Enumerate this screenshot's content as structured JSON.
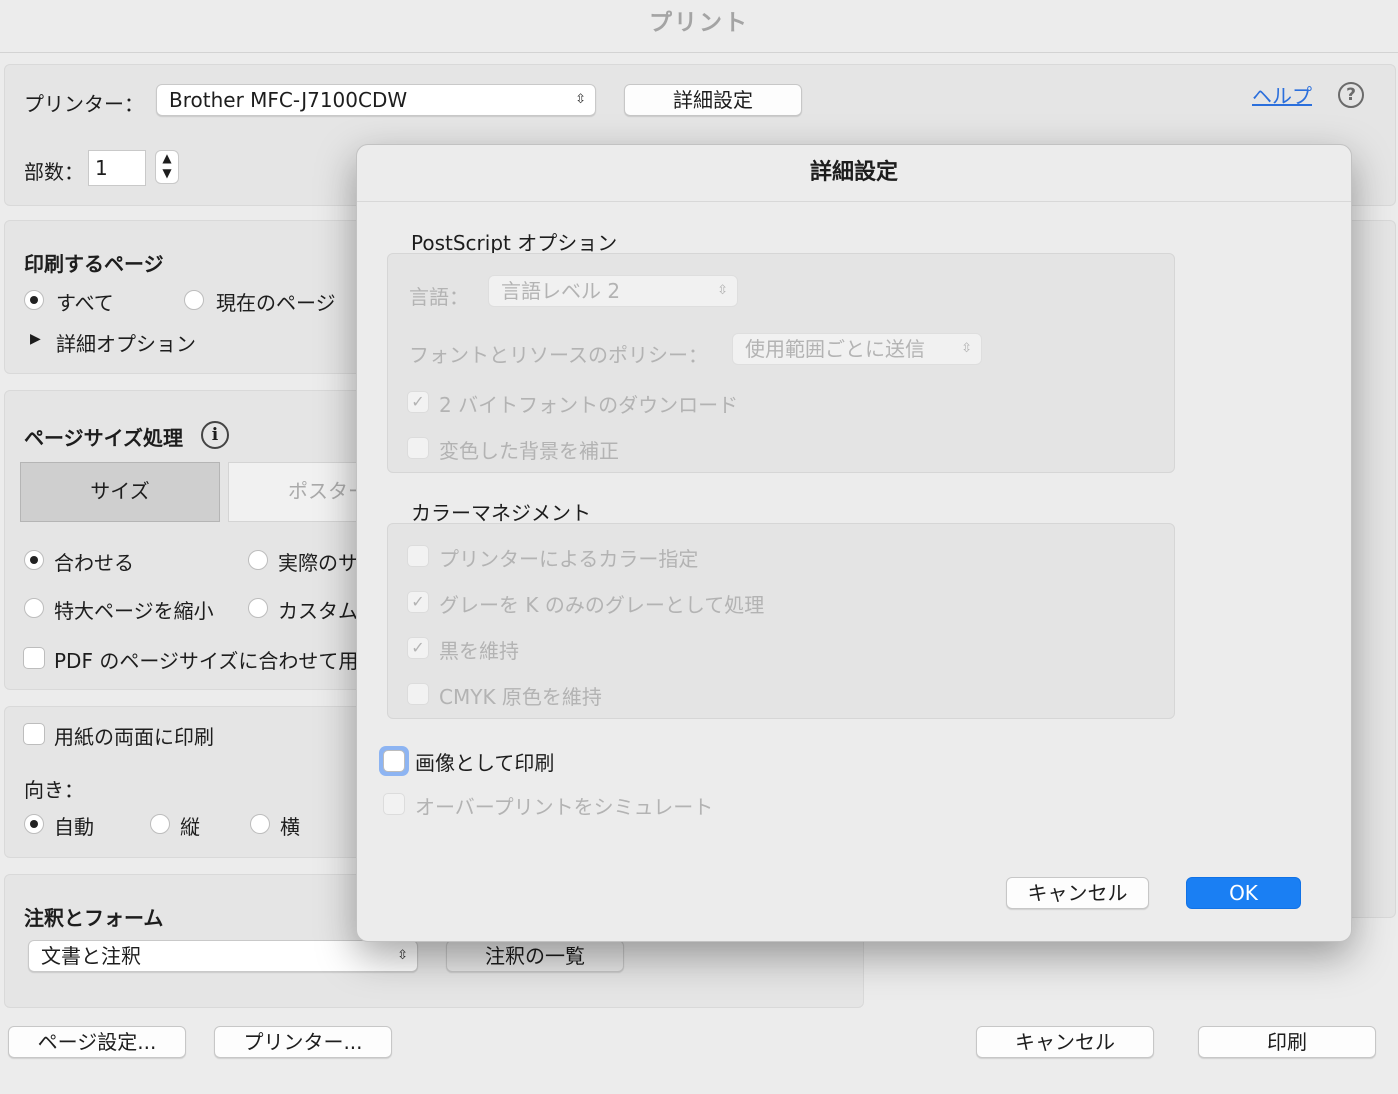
{
  "window": {
    "title": "プリント"
  },
  "printer": {
    "label": "プリンター：",
    "selected": "Brother MFC-J7100CDW",
    "details_button": "詳細設定",
    "help_link": "ヘルプ",
    "help_icon": "question-circle-icon"
  },
  "copies": {
    "label": "部数：",
    "value": "1"
  },
  "pages": {
    "heading": "印刷するページ",
    "option_all": "すべて",
    "option_current": "現在のページ",
    "more_options": "詳細オプション",
    "selected": "すべて"
  },
  "page_sizing": {
    "heading": "ページサイズ処理",
    "info_icon": "info-circle-icon",
    "tabs": [
      "サイズ",
      "ポスター"
    ],
    "option_fit": "合わせる",
    "option_actual": "実際のサ",
    "option_shrink": "特大ページを縮小",
    "option_custom": "カスタム",
    "pdf_checkbox": "PDF のページサイズに合わせて用",
    "selected": "合わせる"
  },
  "duplex": {
    "checkbox": "用紙の両面に印刷",
    "orientation_label": "向き：",
    "option_auto": "自動",
    "option_portrait": "縦",
    "option_landscape": "横",
    "selected": "自動"
  },
  "annotations": {
    "heading": "注釈とフォーム",
    "selected": "文書と注釈",
    "summary_button": "注釈の一覧"
  },
  "footer": {
    "page_setup": "ページ設定...",
    "printer": "プリンター...",
    "cancel": "キャンセル",
    "print": "印刷"
  },
  "sheet": {
    "title": "詳細設定",
    "postscript": {
      "heading": "PostScript オプション",
      "language_label": "言語：",
      "language_value": "言語レベル 2",
      "font_policy_label": "フォントとリソースのポリシー：",
      "font_policy_value": "使用範囲ごとに送信",
      "download_2byte": "2 バイトフォントのダウンロード",
      "correct_background": "変色した背景を補正"
    },
    "color": {
      "heading": "カラーマネジメント",
      "printer_color": "プリンターによるカラー指定",
      "gray_as_k": "グレーを K のみのグレーとして処理",
      "keep_black": "黒を維持",
      "keep_cmyk": "CMYK 原色を維持"
    },
    "print_as_image": "画像として印刷",
    "simulate_overprint": "オーバープリントをシミュレート",
    "cancel": "キャンセル",
    "ok": "OK"
  }
}
